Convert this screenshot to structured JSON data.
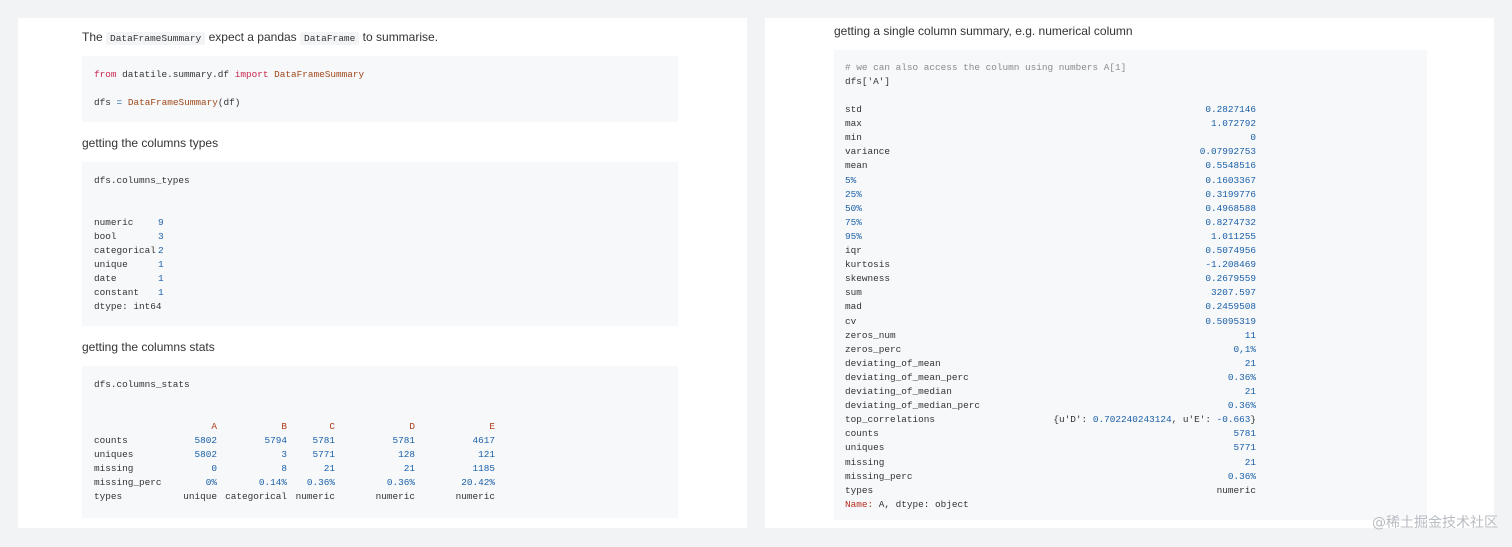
{
  "left": {
    "intro": {
      "the": "The",
      "code1": "DataFrameSummary",
      "mid": "expect a pandas",
      "code2": "DataFrame",
      "end": "to summarise."
    },
    "import_block": {
      "kw_from": "from",
      "module": "datatile.summary.df",
      "kw_import": "import",
      "cls": "DataFrameSummary",
      "line2_var": "dfs",
      "line2_eq": "=",
      "line2_call": "DataFrameSummary",
      "line2_arg": "(df)"
    },
    "types_heading": "getting the columns types",
    "types_block": {
      "command": "dfs.columns_types",
      "rows": [
        {
          "label": "numeric",
          "value": "9"
        },
        {
          "label": "bool",
          "value": "3"
        },
        {
          "label": "categorical",
          "value": "2"
        },
        {
          "label": "unique",
          "value": "1"
        },
        {
          "label": "date",
          "value": "1"
        },
        {
          "label": "constant",
          "value": "1"
        }
      ],
      "dtype": "dtype: int64"
    },
    "stats_heading": "getting the columns stats",
    "stats_block": {
      "command": "dfs.columns_stats",
      "columns": [
        "A",
        "B",
        "C",
        "D",
        "E"
      ],
      "rows": [
        {
          "label": "counts",
          "values": [
            "5802",
            "5794",
            "5781",
            "5781",
            "4617"
          ]
        },
        {
          "label": "uniques",
          "values": [
            "5802",
            "3",
            "5771",
            "128",
            "121"
          ]
        },
        {
          "label": "missing",
          "values": [
            "0",
            "8",
            "21",
            "21",
            "1185"
          ]
        },
        {
          "label": "missing_perc",
          "values": [
            "0%",
            "0.14%",
            "0.36%",
            "0.36%",
            "20.42%"
          ]
        },
        {
          "label": "types",
          "values": [
            "unique",
            "categorical",
            "numeric",
            "numeric",
            "numeric"
          ]
        }
      ]
    }
  },
  "right": {
    "heading": "getting a single column summary, e.g. numerical column",
    "block": {
      "comment": "# we can also access the column using numbers A[1]",
      "command": "dfs['A']",
      "rows": [
        {
          "label": "std",
          "value": "0.2827146"
        },
        {
          "label": "max",
          "value": "1.072792"
        },
        {
          "label": "min",
          "value": "0"
        },
        {
          "label": "variance",
          "value": "0.07992753"
        },
        {
          "label": "mean",
          "value": "0.5548516"
        },
        {
          "label": "5%",
          "value": "0.1603367"
        },
        {
          "label": "25%",
          "value": "0.3199776"
        },
        {
          "label": "50%",
          "value": "0.4968588"
        },
        {
          "label": "75%",
          "value": "0.8274732"
        },
        {
          "label": "95%",
          "value": "1.011255"
        },
        {
          "label": "iqr",
          "value": "0.5074956"
        },
        {
          "label": "kurtosis",
          "value": "-1.208469"
        },
        {
          "label": "skewness",
          "value": "0.2679559"
        },
        {
          "label": "sum",
          "value": "3207.597"
        },
        {
          "label": "mad",
          "value": "0.2459508"
        },
        {
          "label": "cv",
          "value": "0.5095319"
        },
        {
          "label": "zeros_num",
          "value": "11"
        },
        {
          "label": "zeros_perc",
          "value": "0,1%"
        },
        {
          "label": "deviating_of_mean",
          "value": "21"
        },
        {
          "label": "deviating_of_mean_perc",
          "value": "0.36%"
        },
        {
          "label": "deviating_of_median",
          "value": "21"
        },
        {
          "label": "deviating_of_median_perc",
          "value": "0.36%"
        },
        {
          "label": "top_correlations",
          "value": "{u'D': 0.702240243124, u'E': -0.663}"
        },
        {
          "label": "counts",
          "value": "5781"
        },
        {
          "label": "uniques",
          "value": "5771"
        },
        {
          "label": "missing",
          "value": "21"
        },
        {
          "label": "missing_perc",
          "value": "0.36%"
        },
        {
          "label": "types",
          "value": "numeric"
        }
      ],
      "footer_name": "Name:",
      "footer_rest": " A, dtype: object"
    }
  },
  "watermark": "@稀土掘金技术社区",
  "colors": {
    "keyword": "#c7254e",
    "number": "#1a5fa8",
    "column_header": "#b03a1a",
    "code_bg": "#f6f8fa"
  }
}
